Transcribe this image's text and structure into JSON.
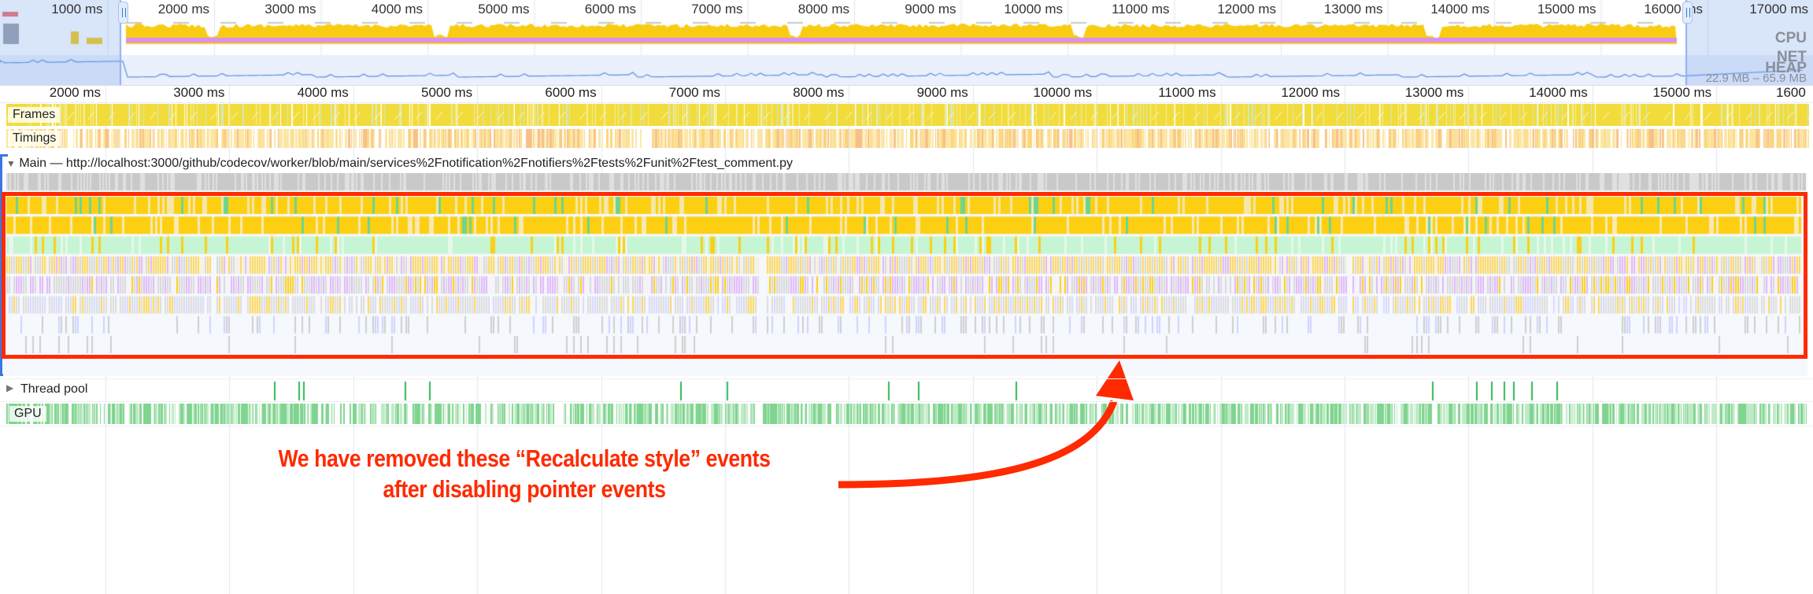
{
  "overview": {
    "time_labels": [
      "1000 ms",
      "2000 ms",
      "3000 ms",
      "4000 ms",
      "5000 ms",
      "6000 ms",
      "7000 ms",
      "8000 ms",
      "9000 ms",
      "10000 ms",
      "11000 ms",
      "12000 ms",
      "13000 ms",
      "14000 ms",
      "15000 ms",
      "16000 ms",
      "17000 ms"
    ],
    "cpu_label": "CPU",
    "net_label": "NET",
    "heap_label": "HEAP",
    "heap_range": "22.9 MB – 65.9 MB"
  },
  "ruler": {
    "time_labels": [
      "2000 ms",
      "3000 ms",
      "4000 ms",
      "5000 ms",
      "6000 ms",
      "7000 ms",
      "8000 ms",
      "9000 ms",
      "10000 ms",
      "11000 ms",
      "12000 ms",
      "13000 ms",
      "14000 ms",
      "15000 ms",
      "1600"
    ]
  },
  "tracks": {
    "frames": "Frames",
    "timings": "Timings",
    "main": "Main — http://localhost:3000/github/codecov/worker/blob/main/services%2Fnotification%2Fnotifiers%2Ftests%2Funit%2Ftest_comment.py",
    "thread_pool": "Thread pool",
    "gpu": "GPU"
  },
  "annotation": {
    "line1": "We have removed these “Recalculate style” events",
    "line2": "after disabling pointer events"
  },
  "colors": {
    "highlight": "#ff2a00",
    "cpu_scripting": "#f9cc14",
    "cpu_rendering": "#d98ff5",
    "heap": "#5b8ee6",
    "gpu": "#3fbf5f",
    "selection": "#3a78e0"
  },
  "icons": [
    "expand-triangle-icon",
    "collapse-triangle-icon",
    "range-handle-icon",
    "arrow-annotation-icon"
  ]
}
